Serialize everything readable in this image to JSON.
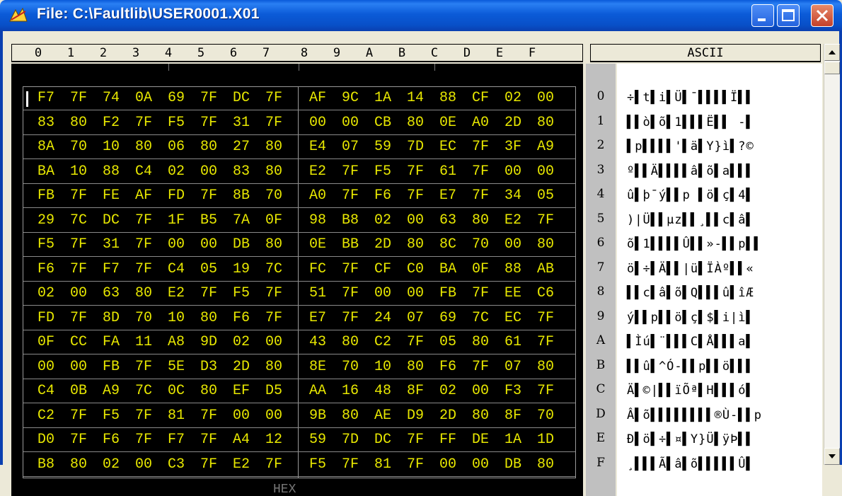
{
  "window": {
    "title": "File: C:\\Faultlib\\USER0001.X01"
  },
  "hex_header": {
    "columns": [
      "0",
      "1",
      "2",
      "3",
      "4",
      "5",
      "6",
      "7",
      "8",
      "9",
      "A",
      "B",
      "C",
      "D",
      "E",
      "F"
    ]
  },
  "ascii_header": {
    "label": "ASCII"
  },
  "hex_footer": {
    "label": "HEX"
  },
  "row_labels": [
    "0",
    "1",
    "2",
    "3",
    "4",
    "5",
    "6",
    "7",
    "8",
    "9",
    "A",
    "B",
    "C",
    "D",
    "E",
    "F"
  ],
  "hex_rows": [
    [
      "F7",
      "7F",
      "74",
      "0A",
      "69",
      "7F",
      "DC",
      "7F",
      "AF",
      "9C",
      "1A",
      "14",
      "88",
      "CF",
      "02",
      "00"
    ],
    [
      "83",
      "80",
      "F2",
      "7F",
      "F5",
      "7F",
      "31",
      "7F",
      "00",
      "00",
      "CB",
      "80",
      "0E",
      "A0",
      "2D",
      "80"
    ],
    [
      "8A",
      "70",
      "10",
      "80",
      "06",
      "80",
      "27",
      "80",
      "E4",
      "07",
      "59",
      "7D",
      "EC",
      "7F",
      "3F",
      "A9"
    ],
    [
      "BA",
      "10",
      "88",
      "C4",
      "02",
      "00",
      "83",
      "80",
      "E2",
      "7F",
      "F5",
      "7F",
      "61",
      "7F",
      "00",
      "00"
    ],
    [
      "FB",
      "7F",
      "FE",
      "AF",
      "FD",
      "7F",
      "8B",
      "70",
      "A0",
      "7F",
      "F6",
      "7F",
      "E7",
      "7F",
      "34",
      "05"
    ],
    [
      "29",
      "7C",
      "DC",
      "7F",
      "1F",
      "B5",
      "7A",
      "0F",
      "98",
      "B8",
      "02",
      "00",
      "63",
      "80",
      "E2",
      "7F"
    ],
    [
      "F5",
      "7F",
      "31",
      "7F",
      "00",
      "00",
      "DB",
      "80",
      "0E",
      "BB",
      "2D",
      "80",
      "8C",
      "70",
      "00",
      "80"
    ],
    [
      "F6",
      "7F",
      "F7",
      "7F",
      "C4",
      "05",
      "19",
      "7C",
      "FC",
      "7F",
      "CF",
      "C0",
      "BA",
      "0F",
      "88",
      "AB"
    ],
    [
      "02",
      "00",
      "63",
      "80",
      "E2",
      "7F",
      "F5",
      "7F",
      "51",
      "7F",
      "00",
      "00",
      "FB",
      "7F",
      "EE",
      "C6"
    ],
    [
      "FD",
      "7F",
      "8D",
      "70",
      "10",
      "80",
      "F6",
      "7F",
      "E7",
      "7F",
      "24",
      "07",
      "69",
      "7C",
      "EC",
      "7F"
    ],
    [
      "0F",
      "CC",
      "FA",
      "11",
      "A8",
      "9D",
      "02",
      "00",
      "43",
      "80",
      "C2",
      "7F",
      "05",
      "80",
      "61",
      "7F"
    ],
    [
      "00",
      "00",
      "FB",
      "7F",
      "5E",
      "D3",
      "2D",
      "80",
      "8E",
      "70",
      "10",
      "80",
      "F6",
      "7F",
      "07",
      "80"
    ],
    [
      "C4",
      "0B",
      "A9",
      "7C",
      "0C",
      "80",
      "EF",
      "D5",
      "AA",
      "16",
      "48",
      "8F",
      "02",
      "00",
      "F3",
      "7F"
    ],
    [
      "C2",
      "7F",
      "F5",
      "7F",
      "81",
      "7F",
      "00",
      "00",
      "9B",
      "80",
      "AE",
      "D9",
      "2D",
      "80",
      "8F",
      "70"
    ],
    [
      "D0",
      "7F",
      "F6",
      "7F",
      "F7",
      "7F",
      "A4",
      "12",
      "59",
      "7D",
      "DC",
      "7F",
      "FF",
      "DE",
      "1A",
      "1D"
    ],
    [
      "B8",
      "80",
      "02",
      "00",
      "C3",
      "7F",
      "E2",
      "7F",
      "F5",
      "7F",
      "81",
      "7F",
      "00",
      "00",
      "DB",
      "80"
    ]
  ],
  "ascii_rows": [
    "÷▌t▌i▌Ü▌¯▌▌▌▌Ï▌▌",
    "▌▌ò▌õ▌1▌▌▌Ë▌▌ -▌",
    "▌p▌▌▌▌'▌ä▌Y}ì▌?©",
    "º▌▌Ä▌▌▌▌â▌õ▌a▌▌▌",
    "û▌þ¯ý▌▌p ▌ö▌ç▌4▌",
    ")|Ü▌▌µz▌▌¸▌▌c▌â▌",
    "õ▌1▌▌▌▌Û▌▌»-▌▌p▌▌",
    "ö▌÷▌Ä▌▌|ü▌ÏÀº▌▌«",
    "▌▌c▌â▌õ▌Q▌▌▌û▌îÆ",
    "ý▌▌p▌▌ö▌ç▌$▌i|ì▌",
    "▌Ìú▌¨▌▌▌C▌Å▌▌▌a▌",
    "▌▌û▌^Ó-▌▌p▌▌ö▌▌▌",
    "Ä▌©|▌▌ïÕª▌H▌▌▌ó▌",
    "Â▌õ▌▌▌▌▌▌▌▌®Ù-▌▌p",
    "Ð▌ö▌÷▌¤▌Y}Ü▌ÿÞ▌▌",
    "¸▌▌▌Ã▌â▌õ▌▌▌▌▌Û▌"
  ],
  "colors": {
    "hex_text": "#e8e800",
    "hex_bg": "#000000",
    "titlebar": "#0b5bd8",
    "close_button": "#c4402a"
  },
  "icons": [
    "app-icon",
    "minimize-icon",
    "maximize-icon",
    "close-icon",
    "scroll-up-icon",
    "scroll-down-icon"
  ]
}
